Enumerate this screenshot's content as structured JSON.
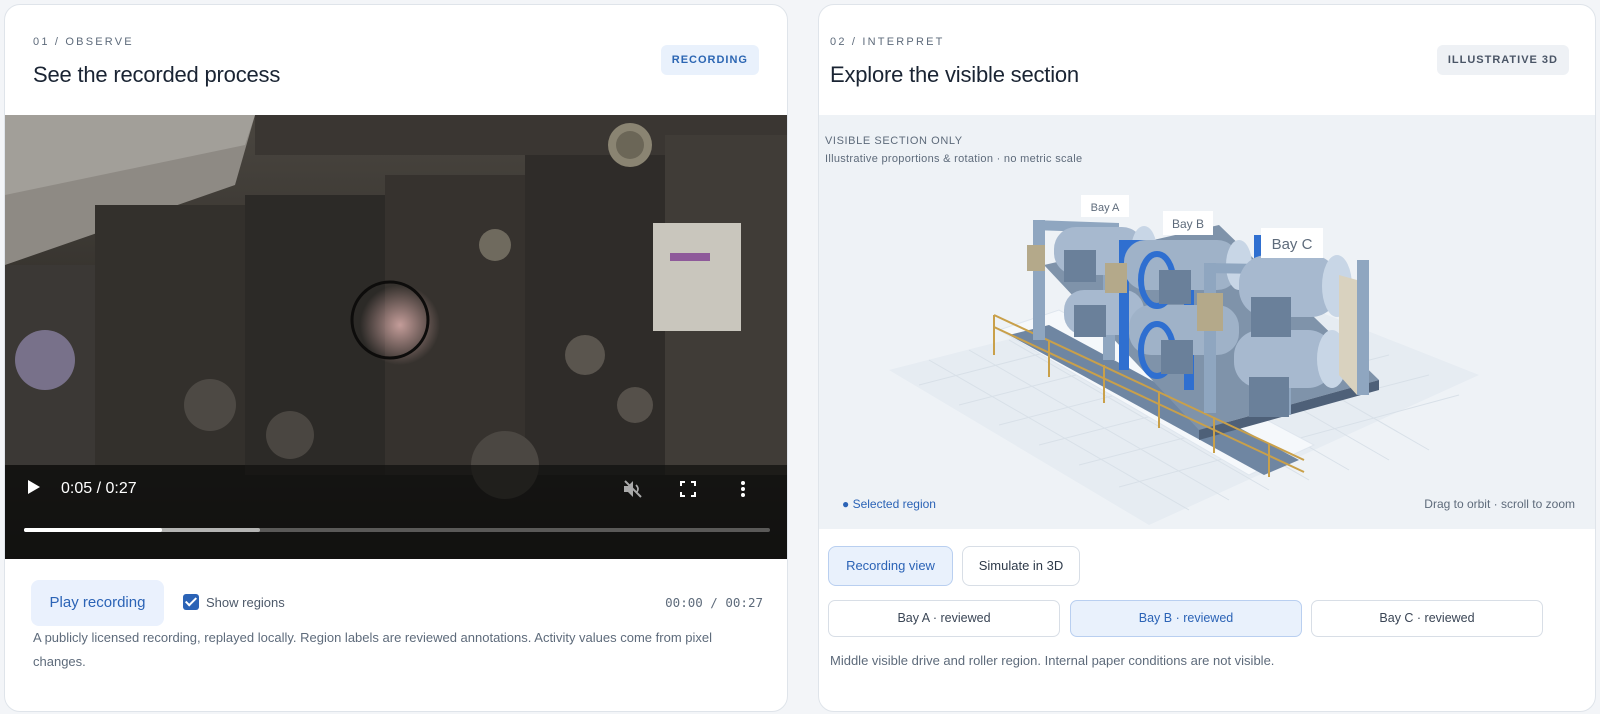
{
  "left_panel": {
    "eyebrow": "01 / OBSERVE",
    "title": "See the recorded process",
    "badge": "RECORDING",
    "video": {
      "time_display": "0:05 / 0:27",
      "progress_fraction": 0.185,
      "buffer_fraction": 0.317,
      "icons": [
        "play-icon",
        "mute-icon",
        "fullscreen-icon",
        "more-icon"
      ]
    },
    "play_button": "Play recording",
    "show_regions": {
      "label": "Show regions",
      "checked": true
    },
    "timecode": "00:00 / 00:27",
    "caption": "A publicly licensed recording, replayed locally. Region labels are reviewed annotations. Activity values come from pixel changes."
  },
  "right_panel": {
    "eyebrow": "02 / INTERPRET",
    "title": "Explore the visible section",
    "badge": "ILLUSTRATIVE 3D",
    "view": {
      "heading": "VISIBLE SECTION ONLY",
      "subheading": "Illustrative proportions & rotation · no metric scale",
      "bay_labels": [
        "Bay A",
        "Bay B",
        "Bay C"
      ],
      "selected_region": "● Selected region",
      "hint": "Drag to orbit · scroll to zoom"
    },
    "mode_buttons": [
      "Recording view",
      "Simulate in 3D"
    ],
    "active_mode": "Recording view",
    "bay_buttons": [
      "Bay A · reviewed",
      "Bay B · reviewed",
      "Bay C · reviewed"
    ],
    "active_bay": "Bay B · reviewed",
    "description": "Middle visible drive and roller region. Internal paper conditions are not visible.",
    "colors": {
      "accent": "#2b63b6",
      "selected_bay": "#2f6fd0",
      "frame": "#8fa6c0"
    }
  }
}
